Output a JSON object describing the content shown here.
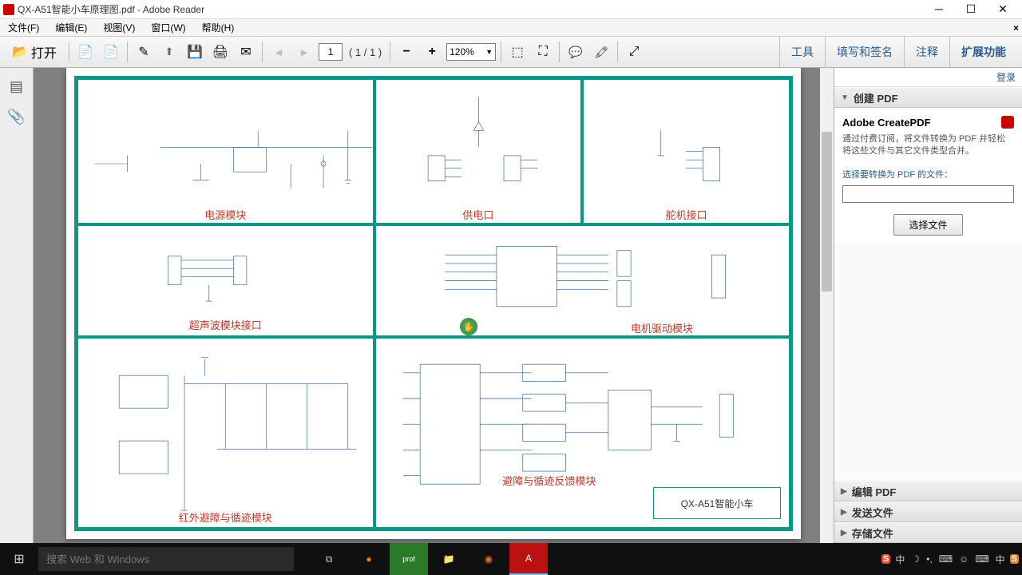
{
  "window": {
    "title": "QX-A51智能小车原理图.pdf - Adobe Reader"
  },
  "menu": {
    "file": "文件(F)",
    "edit": "编辑(E)",
    "view": "视图(V)",
    "window": "窗口(W)",
    "help": "帮助(H)"
  },
  "toolbar": {
    "open": "打开",
    "page_current": "1",
    "page_of": "( 1 / 1 )",
    "zoom": "120%",
    "tools": "工具",
    "fill_sign": "填写和签名",
    "comment": "注释",
    "extend": "扩展功能"
  },
  "schematic": {
    "block1": "电源模块",
    "block2": "供电口",
    "block3": "舵机接口",
    "block4": "超声波模块接口",
    "block5": "电机驱动模块",
    "block6": "红外避障与循迹模块",
    "block7": "避障与循迹反馈模块",
    "title_box": "QX-A51智能小车"
  },
  "right_panel": {
    "login": "登录",
    "create_pdf": "创建 PDF",
    "product": "Adobe CreatePDF",
    "desc": "通过付费订阅，将文件转换为 PDF 并轻松将这些文件与其它文件类型合并。",
    "select_label": "选择要转换为 PDF 的文件：",
    "select_btn": "选择文件",
    "edit_pdf": "编辑 PDF",
    "send_file": "发送文件",
    "store_file": "存储文件"
  },
  "taskbar": {
    "search_placeholder": "搜索 Web 和 Windows",
    "ime": "S",
    "tray1": "中",
    "tray2": "中"
  }
}
